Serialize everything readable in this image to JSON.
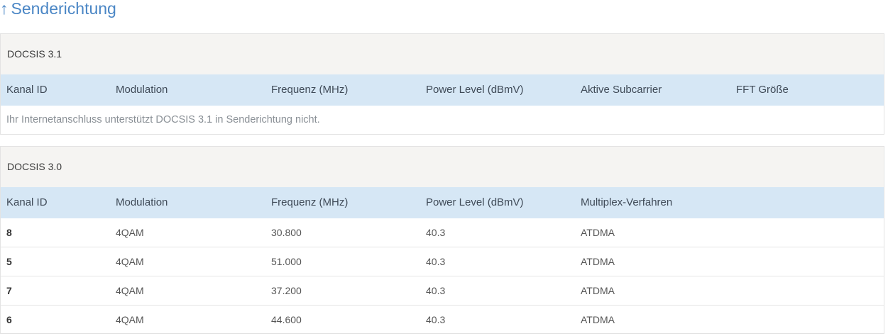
{
  "section": {
    "arrow": "↑",
    "title": "Senderichtung"
  },
  "docsis31": {
    "title": "DOCSIS 3.1",
    "columns": [
      "Kanal ID",
      "Modulation",
      "Frequenz (MHz)",
      "Power Level (dBmV)",
      "Aktive Subcarrier",
      "FFT Größe"
    ],
    "note": "Ihr Internetanschluss unterstützt DOCSIS 3.1 in Senderichtung nicht."
  },
  "docsis30": {
    "title": "DOCSIS 3.0",
    "columns": [
      "Kanal ID",
      "Modulation",
      "Frequenz (MHz)",
      "Power Level (dBmV)",
      "Multiplex-Verfahren"
    ],
    "rows": [
      [
        "8",
        "4QAM",
        "30.800",
        "40.3",
        "ATDMA"
      ],
      [
        "5",
        "4QAM",
        "51.000",
        "40.3",
        "ATDMA"
      ],
      [
        "7",
        "4QAM",
        "37.200",
        "40.3",
        "ATDMA"
      ],
      [
        "6",
        "4QAM",
        "44.600",
        "40.3",
        "ATDMA"
      ]
    ]
  },
  "colors": {
    "heading": "#4a86c5",
    "header_row": "#d6e7f5",
    "panel_title_bg": "#f5f4f2"
  }
}
